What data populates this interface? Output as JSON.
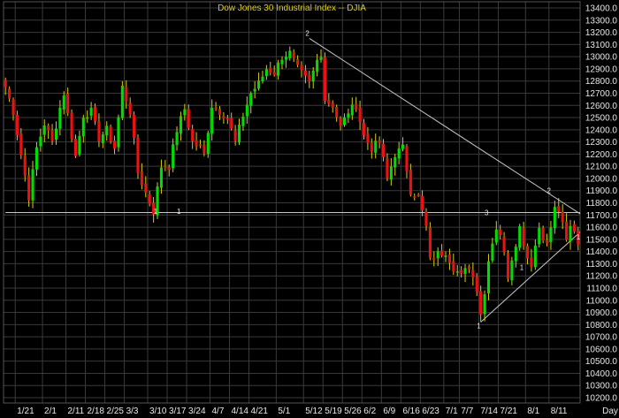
{
  "chart_data": {
    "type": "candlestick",
    "title": "Dow Jones 30 Industrial Index -- DJIA",
    "x_unit_label": "Day",
    "grid": true,
    "ylim": [
      10100,
      13500
    ],
    "yticks": [
      10200,
      10300,
      10400,
      10500,
      10600,
      10700,
      10800,
      10900,
      11000,
      11100,
      11200,
      11300,
      11400,
      11500,
      11600,
      11700,
      11800,
      11900,
      12000,
      12100,
      12200,
      12300,
      12400,
      12500,
      12600,
      12700,
      12800,
      12900,
      13000,
      13100,
      13200,
      13300,
      13400
    ],
    "ytick_labels": [
      "10200.0",
      "10300.0",
      "10400.0",
      "10500.0",
      "10600.0",
      "10700.0",
      "10800.0",
      "10900.0",
      "11000.0",
      "11100.0",
      "11200.0",
      "11300.0",
      "11400.0",
      "11500.0",
      "11600.0",
      "11700.0",
      "11800.0",
      "11900.0",
      "12000.0",
      "12100.0",
      "12200.0",
      "12300.0",
      "12400.0",
      "12500.0",
      "12600.0",
      "12700.0",
      "12800.0",
      "12900.0",
      "13000.0",
      "13100.0",
      "13200.0",
      "13300.0",
      "13400.0"
    ],
    "xtick_labels": [
      "1/21",
      "2/1",
      "2/11",
      "2/18",
      "2/25",
      "3/3",
      "3/10",
      "3/17",
      "3/24",
      "4/7",
      "4/14",
      "4/21",
      "5/1",
      "5/12",
      "5/19",
      "5/26",
      "6/2",
      "6/9",
      "6/16",
      "6/23",
      "7/1",
      "7/7",
      "7/14",
      "7/21",
      "8/1",
      "8/11"
    ],
    "xtick_positions": [
      3,
      10,
      16,
      21,
      26,
      31,
      37,
      42,
      47,
      53,
      58,
      63,
      70,
      77,
      82,
      87,
      92,
      97,
      102,
      107,
      113,
      117,
      122,
      127,
      134,
      140
    ],
    "n_bars": 148,
    "anchors": [
      [
        0,
        12750
      ],
      [
        2,
        12550
      ],
      [
        4,
        12200
      ],
      [
        6,
        11850
      ],
      [
        8,
        12250
      ],
      [
        10,
        12450
      ],
      [
        12,
        12300
      ],
      [
        14,
        12580
      ],
      [
        15,
        12700
      ],
      [
        17,
        12350
      ],
      [
        18,
        12180
      ],
      [
        20,
        12520
      ],
      [
        22,
        12550
      ],
      [
        24,
        12330
      ],
      [
        26,
        12400
      ],
      [
        28,
        12250
      ],
      [
        30,
        12750
      ],
      [
        32,
        12550
      ],
      [
        34,
        12050
      ],
      [
        36,
        11880
      ],
      [
        38,
        11730
      ],
      [
        40,
        12100
      ],
      [
        42,
        12100
      ],
      [
        44,
        12400
      ],
      [
        46,
        12570
      ],
      [
        48,
        12300
      ],
      [
        50,
        12250
      ],
      [
        51,
        12200
      ],
      [
        53,
        12600
      ],
      [
        55,
        12550
      ],
      [
        57,
        12500
      ],
      [
        59,
        12300
      ],
      [
        61,
        12520
      ],
      [
        63,
        12700
      ],
      [
        65,
        12780
      ],
      [
        67,
        12900
      ],
      [
        69,
        12870
      ],
      [
        71,
        13000
      ],
      [
        73,
        13030
      ],
      [
        75,
        12900
      ],
      [
        77,
        12820
      ],
      [
        78,
        12780
      ],
      [
        80,
        12970
      ],
      [
        81,
        13030
      ],
      [
        82,
        12650
      ],
      [
        84,
        12600
      ],
      [
        86,
        12420
      ],
      [
        88,
        12550
      ],
      [
        90,
        12600
      ],
      [
        92,
        12350
      ],
      [
        94,
        12250
      ],
      [
        96,
        12300
      ],
      [
        98,
        12000
      ],
      [
        100,
        12200
      ],
      [
        102,
        12250
      ],
      [
        104,
        11900
      ],
      [
        106,
        11850
      ],
      [
        108,
        11600
      ],
      [
        109,
        11320
      ],
      [
        111,
        11380
      ],
      [
        113,
        11400
      ],
      [
        115,
        11270
      ],
      [
        117,
        11200
      ],
      [
        119,
        11280
      ],
      [
        121,
        11100
      ],
      [
        122,
        10900
      ],
      [
        123,
        11050
      ],
      [
        124,
        11350
      ],
      [
        126,
        11600
      ],
      [
        127,
        11550
      ],
      [
        129,
        11200
      ],
      [
        130,
        11350
      ],
      [
        132,
        11600
      ],
      [
        134,
        11350
      ],
      [
        135,
        11300
      ],
      [
        137,
        11600
      ],
      [
        139,
        11450
      ],
      [
        140,
        11600
      ],
      [
        141,
        11750
      ],
      [
        142,
        11740
      ],
      [
        144,
        11480
      ],
      [
        145,
        11600
      ],
      [
        146,
        11580
      ],
      [
        147,
        11470
      ]
    ],
    "trendlines": [
      {
        "from": [
          78,
          13150
        ],
        "to": [
          148,
          11710
        ]
      },
      {
        "from": [
          122,
          10820
        ],
        "to": [
          148,
          11560
        ]
      },
      {
        "from": [
          0,
          11720
        ],
        "to": [
          148,
          11720
        ]
      }
    ],
    "annotations": [
      {
        "text": "2",
        "x": 78,
        "y": 13170
      },
      {
        "text": "1",
        "x": 122,
        "y": 10770
      },
      {
        "text": "1",
        "x": 39,
        "y": 11710
      },
      {
        "text": "1",
        "x": 45,
        "y": 11710
      },
      {
        "text": "2",
        "x": 140,
        "y": 11880
      },
      {
        "text": "3",
        "x": 124,
        "y": 11700
      },
      {
        "text": "1",
        "x": 133,
        "y": 11250
      },
      {
        "text": "1",
        "x": 148,
        "y": 11500
      }
    ]
  },
  "colors": {
    "background": "#000000",
    "grid": "#3a3a3a",
    "up": "#00dd00",
    "down": "#ee1111",
    "wick": "#d8d000",
    "trendline": "#c8c8c8",
    "text": "#e8e8e8",
    "title": "#e0d000"
  }
}
